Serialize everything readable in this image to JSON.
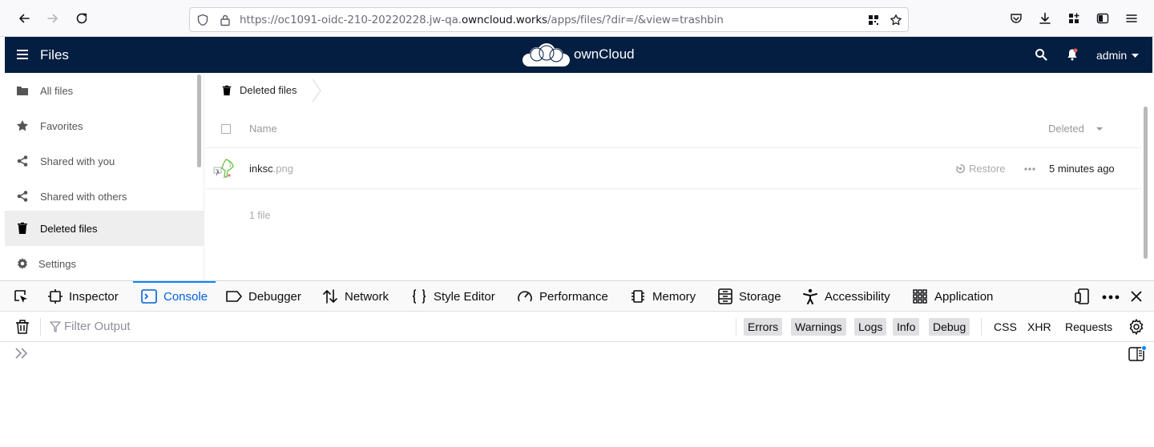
{
  "browser": {
    "url_prefix": "https://oc1091-oidc-210-20220228.jw-qa.",
    "url_domain": "owncloud.works",
    "url_suffix": "/apps/files/?dir=/&view=trashbin"
  },
  "header": {
    "app_title": "Files",
    "brand": "ownCloud",
    "user": "admin"
  },
  "sidebar": {
    "items": [
      {
        "label": "All files",
        "icon": "folder-icon"
      },
      {
        "label": "Favorites",
        "icon": "star-icon"
      },
      {
        "label": "Shared with you",
        "icon": "share-icon"
      },
      {
        "label": "Shared with others",
        "icon": "share-icon"
      },
      {
        "label": "Deleted files",
        "icon": "trash-icon",
        "active": true
      },
      {
        "label": "Settings",
        "icon": "gear-icon"
      }
    ]
  },
  "main": {
    "breadcrumb": "Deleted files",
    "columns": {
      "name": "Name",
      "deleted": "Deleted"
    },
    "files": [
      {
        "basename": "inksc",
        "ext": ".png",
        "action": "Restore",
        "deleted": "5 minutes ago"
      }
    ],
    "summary": "1 file"
  },
  "devtools": {
    "tabs": [
      "Inspector",
      "Console",
      "Debugger",
      "Network",
      "Style Editor",
      "Performance",
      "Memory",
      "Storage",
      "Accessibility",
      "Application"
    ],
    "active_tab": "Console",
    "filter_placeholder": "Filter Output",
    "levels": [
      "Errors",
      "Warnings",
      "Logs",
      "Info",
      "Debug"
    ],
    "extra_filters": [
      "CSS",
      "XHR",
      "Requests"
    ]
  },
  "colors": {
    "header_bg": "#041e42",
    "devtools_accent": "#0a84ff"
  }
}
